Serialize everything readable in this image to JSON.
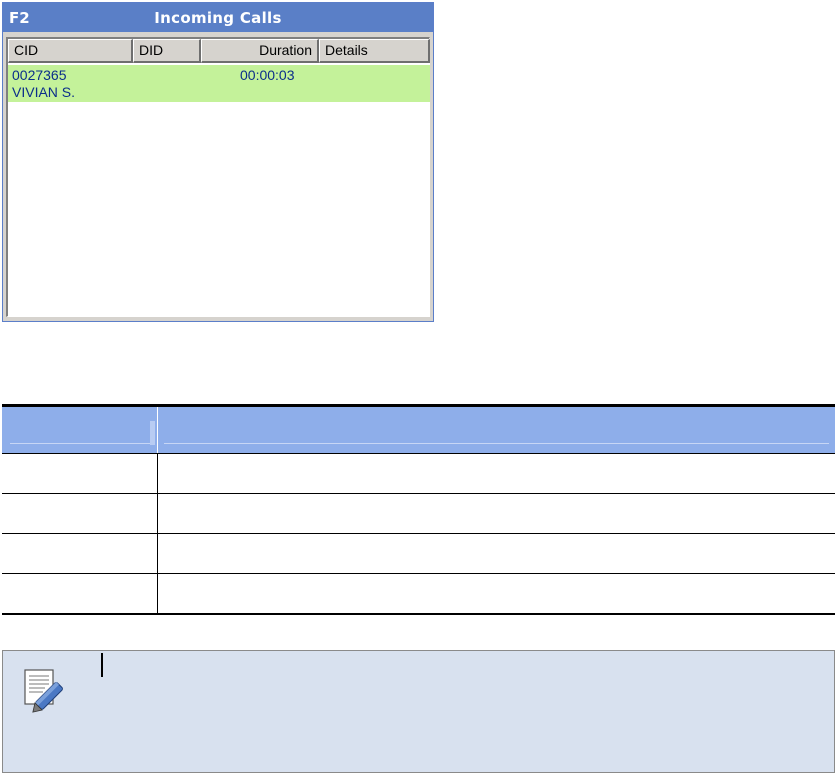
{
  "window": {
    "hotkey": "F2",
    "title": "Incoming Calls",
    "columns": [
      "CID",
      "DID",
      "Duration",
      "Details"
    ],
    "calls": [
      {
        "cid": "0027365",
        "name": "VIVIAN S.",
        "did": "",
        "duration": "00:00:03",
        "details": ""
      }
    ]
  },
  "colors": {
    "title_bar": "#5a7fc7",
    "active_row": "#c4f29a",
    "row_text": "#0b2e8a",
    "table_header": "#8eaeea",
    "note_background": "#d8e1ef"
  },
  "table": {
    "headers": [
      "",
      ""
    ],
    "rows": [
      [
        "",
        ""
      ],
      [
        "",
        ""
      ],
      [
        "",
        ""
      ],
      [
        "",
        ""
      ]
    ]
  },
  "note": {
    "icon": "note-pencil-icon",
    "text": ""
  }
}
